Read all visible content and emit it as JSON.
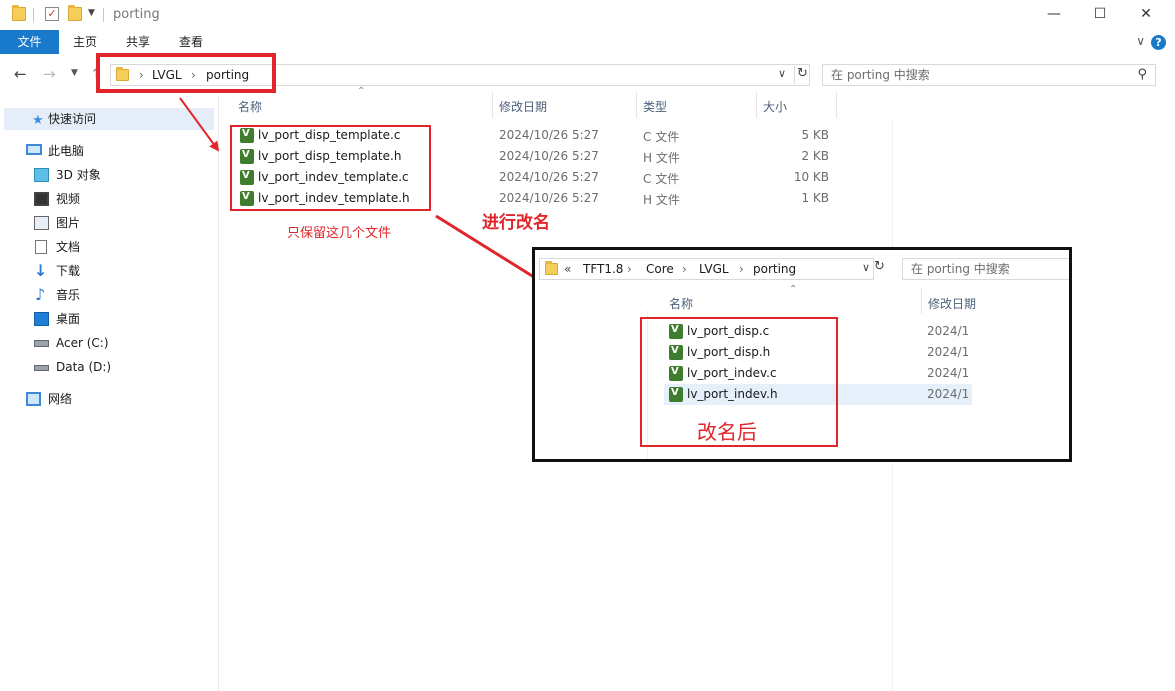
{
  "window": {
    "title": "porting",
    "controls": {
      "minimize": "—",
      "maximize": "☐",
      "close": "✕"
    }
  },
  "ribbon": {
    "tabs": [
      "文件",
      "主页",
      "共享",
      "查看"
    ]
  },
  "nav": {
    "breadcrumb": [
      "LVGL",
      "porting"
    ],
    "search_placeholder": "在 porting 中搜索"
  },
  "sidebar": {
    "items": [
      {
        "label": "快速访问",
        "icon": "star-icon"
      },
      {
        "label": "此电脑",
        "icon": "computer-icon"
      },
      {
        "label": "3D 对象",
        "icon": "cube-icon"
      },
      {
        "label": "视频",
        "icon": "video-icon"
      },
      {
        "label": "图片",
        "icon": "picture-icon"
      },
      {
        "label": "文档",
        "icon": "document-icon"
      },
      {
        "label": "下载",
        "icon": "download-icon"
      },
      {
        "label": "音乐",
        "icon": "music-icon"
      },
      {
        "label": "桌面",
        "icon": "desktop-icon"
      },
      {
        "label": "Acer (C:)",
        "icon": "drive-icon"
      },
      {
        "label": "Data (D:)",
        "icon": "drive-icon"
      },
      {
        "label": "网络",
        "icon": "network-icon"
      }
    ]
  },
  "columns": {
    "name": "名称",
    "modified": "修改日期",
    "type": "类型",
    "size": "大小"
  },
  "files": [
    {
      "name": "lv_port_disp_template.c",
      "modified": "2024/10/26 5:27",
      "type": "C 文件",
      "size": "5 KB"
    },
    {
      "name": "lv_port_disp_template.h",
      "modified": "2024/10/26 5:27",
      "type": "H 文件",
      "size": "2 KB"
    },
    {
      "name": "lv_port_indev_template.c",
      "modified": "2024/10/26 5:27",
      "type": "C 文件",
      "size": "10 KB"
    },
    {
      "name": "lv_port_indev_template.h",
      "modified": "2024/10/26 5:27",
      "type": "H 文件",
      "size": "1 KB"
    }
  ],
  "annotations": {
    "keep_only": "只保留这几个文件",
    "rename": "进行改名",
    "after_rename": "改名后"
  },
  "inset": {
    "breadcrumb_prefix": "«",
    "breadcrumb": [
      "TFT1.8",
      "Core",
      "LVGL",
      "porting"
    ],
    "search_placeholder": "在 porting 中搜索",
    "columns": {
      "name": "名称",
      "modified": "修改日期"
    },
    "files": [
      {
        "name": "lv_port_disp.c",
        "modified": "2024/1"
      },
      {
        "name": "lv_port_disp.h",
        "modified": "2024/1"
      },
      {
        "name": "lv_port_indev.c",
        "modified": "2024/1"
      },
      {
        "name": "lv_port_indev.h",
        "modified": "2024/1"
      }
    ]
  },
  "colors": {
    "accent": "#1979ca",
    "annotation_red": "#e0262b",
    "folder_yellow": "#f5cd5a",
    "file_icon_green": "#3f7d2e"
  }
}
